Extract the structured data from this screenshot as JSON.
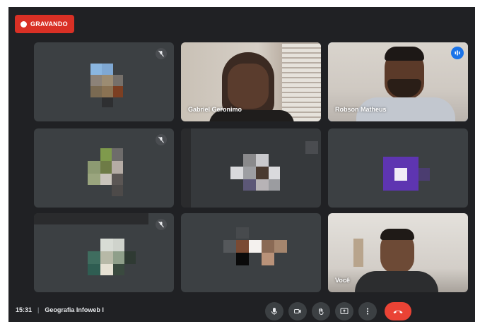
{
  "recording": {
    "label": "GRAVANDO"
  },
  "participants": [
    {
      "name": "",
      "muted": true
    },
    {
      "name": "Gabriel Geronimo",
      "muted": false
    },
    {
      "name": "Robson Matheus",
      "muted": false,
      "speaking": true
    },
    {
      "name": "",
      "muted": true
    },
    {
      "name": "",
      "muted": false
    },
    {
      "name": "",
      "muted": false
    },
    {
      "name": "",
      "muted": true
    },
    {
      "name": "",
      "muted": false
    },
    {
      "name": "Você",
      "muted": false
    }
  ],
  "meeting": {
    "time": "15:31",
    "separator": "|",
    "title": "Geografia Infoweb I"
  },
  "controls": [
    {
      "icon": "mic-icon"
    },
    {
      "icon": "camera-icon"
    },
    {
      "icon": "raise-hand-icon"
    },
    {
      "icon": "present-screen-icon"
    },
    {
      "icon": "more-options-icon"
    },
    {
      "icon": "end-call-icon"
    }
  ],
  "colors": {
    "background": "#202124",
    "tile": "#3c4043",
    "record": "#d93025",
    "end_call": "#ea4335",
    "speaking_outline": "#8ab4f8"
  }
}
